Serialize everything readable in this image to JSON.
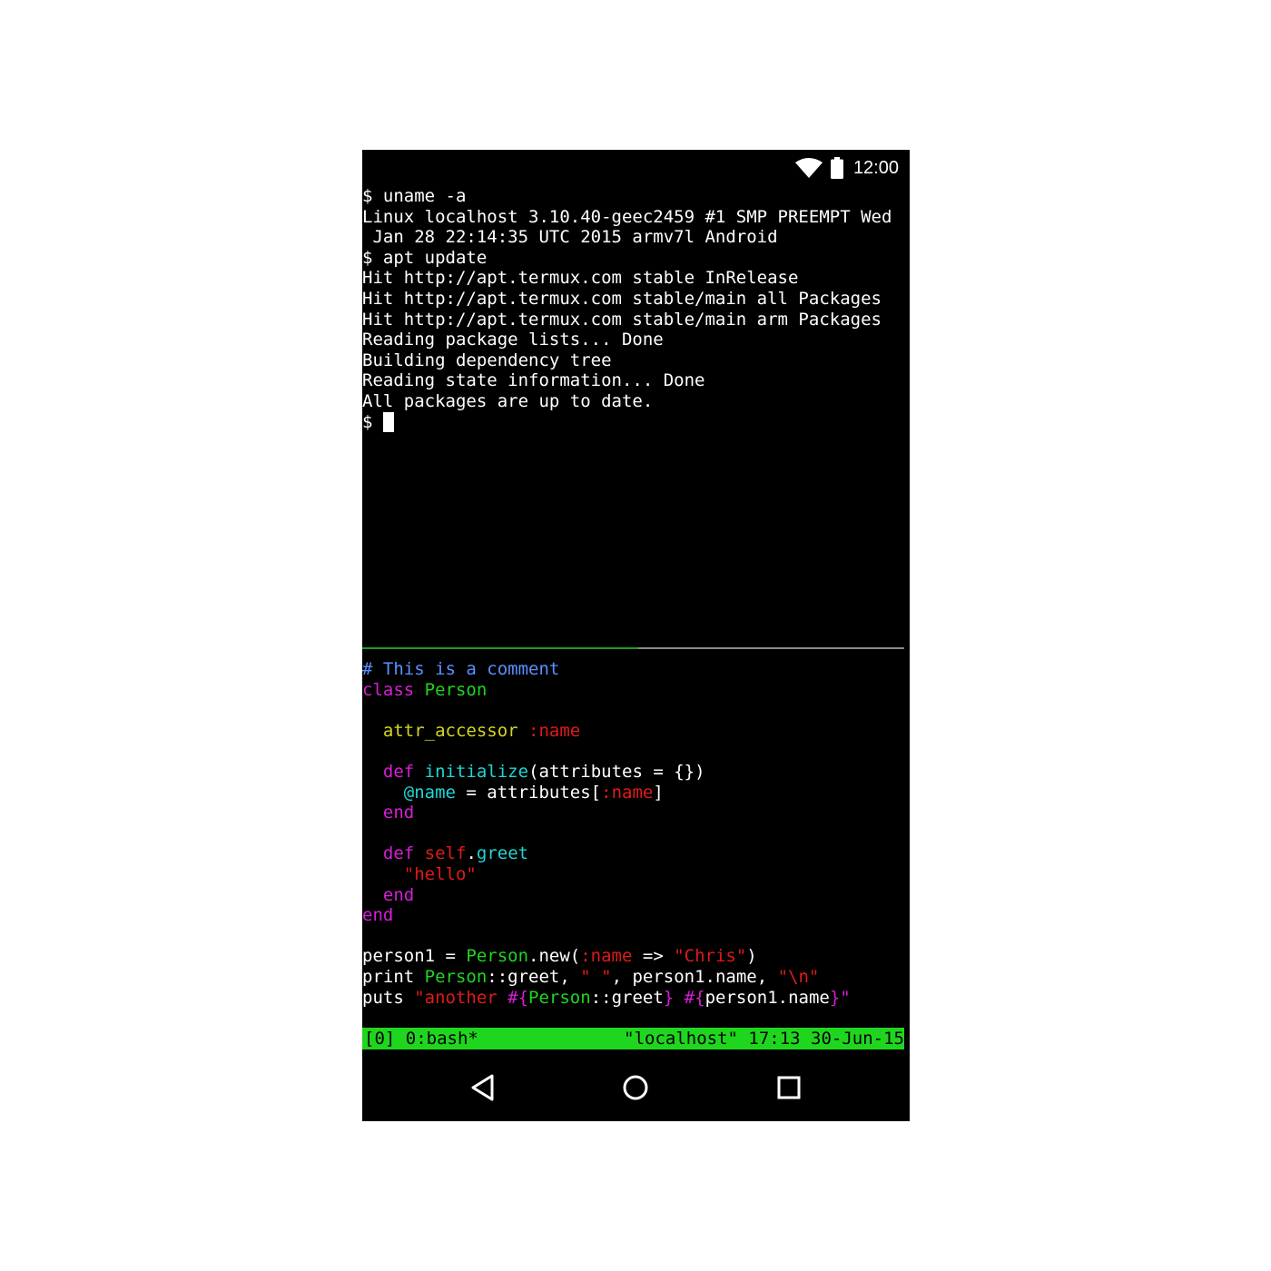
{
  "colors": {
    "terminal_bg": "#000000",
    "text": "#ffffff",
    "tmux_bar": "#1fd61f",
    "divider_active": "#1f9e1f",
    "divider_inactive": "#8a8a8a"
  },
  "status_bar": {
    "icons": [
      "wifi-icon",
      "battery-icon"
    ],
    "time": "12:00"
  },
  "terminal_top": {
    "lines": [
      "$ uname -a",
      "Linux localhost 3.10.40-geec2459 #1 SMP PREEMPT Wed",
      " Jan 28 22:14:35 UTC 2015 armv7l Android",
      "$ apt update",
      "Hit http://apt.termux.com stable InRelease",
      "Hit http://apt.termux.com stable/main all Packages",
      "Hit http://apt.termux.com stable/main arm Packages",
      "Reading package lists... Done",
      "Building dependency tree",
      "Reading state information... Done",
      "All packages are up to date."
    ],
    "prompt": "$ "
  },
  "terminal_bottom": {
    "code": {
      "l1": "# This is a comment",
      "l2_kw": "class",
      "l2_name": " Person",
      "l4_indent": "  ",
      "l4_method": "attr_accessor",
      "l4_sym": " :name",
      "l6_indent": "  ",
      "l6_kw": "def",
      "l6_sp": " ",
      "l6_method": "initialize",
      "l6_args": "(attributes = {})",
      "l7_indent": "    ",
      "l7_ivar": "@name",
      "l7_mid": " = attributes[",
      "l7_sym": ":name",
      "l7_end": "]",
      "l8_indent": "  ",
      "l8_kw": "end",
      "l10_indent": "  ",
      "l10_kw": "def",
      "l10_sp": " ",
      "l10_self": "self",
      "l10_dot": ".",
      "l10_method": "greet",
      "l11_indent": "    ",
      "l11_str": "\"hello\"",
      "l12_indent": "  ",
      "l12_kw": "end",
      "l13_kw": "end",
      "l15_a": "person1 = ",
      "l15_class": "Person",
      "l15_b": ".new(",
      "l15_sym": ":name",
      "l15_c": " => ",
      "l15_str": "\"Chris\"",
      "l15_d": ")",
      "l16_a": "print ",
      "l16_class": "Person",
      "l16_b": "::greet, ",
      "l16_str1": "\" \"",
      "l16_c": ", person1.name, ",
      "l16_str2": "\"\\n\"",
      "l17_a": "puts ",
      "l17_str1": "\"another ",
      "l17_interp1": "#{",
      "l17_class": "Person",
      "l17_b": "::greet",
      "l17_interp1_end": "}",
      "l17_sp": " ",
      "l17_interp2": "#{",
      "l17_c": "person1.name",
      "l17_interp2_end": "}\"",
      "l17_end": ""
    }
  },
  "tmux_status": {
    "left": "[0] 0:bash*",
    "right": "\"localhost\" 17:13 30-Jun-15"
  },
  "nav_bar": {
    "buttons": [
      "back-icon",
      "home-icon",
      "recents-icon"
    ]
  }
}
